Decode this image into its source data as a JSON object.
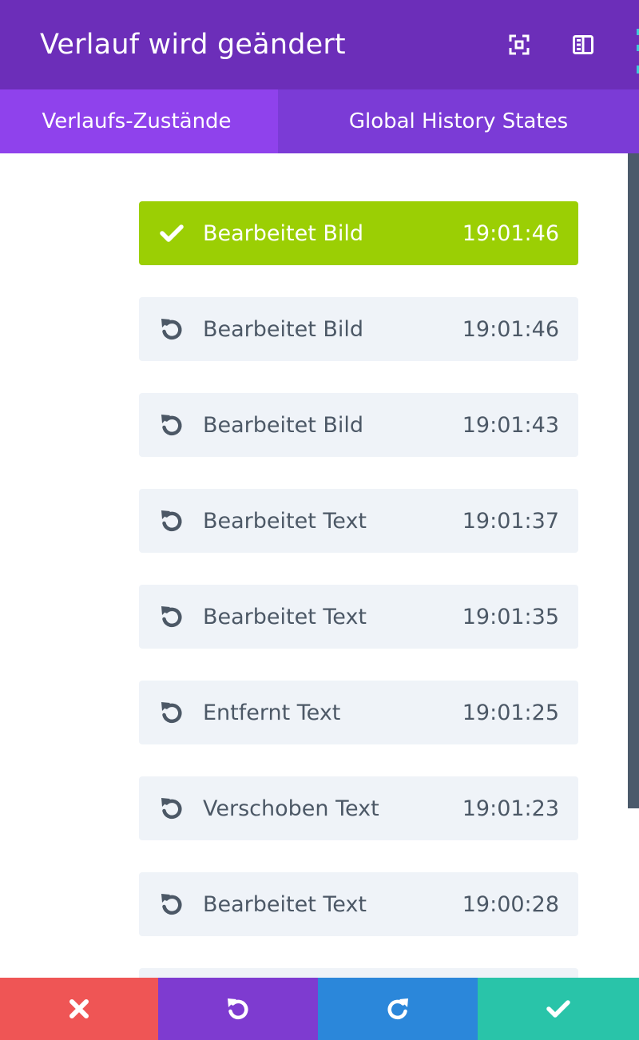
{
  "header": {
    "title": "Verlauf wird geändert",
    "fullscreen_icon": "fullscreen-icon",
    "sidebar_icon": "sidebar-toggle-icon",
    "bg_color": "#6c2eb9"
  },
  "tabs": [
    {
      "label": "Verlaufs-Zustände",
      "active": true
    },
    {
      "label": "Global History States",
      "active": false
    }
  ],
  "history": {
    "items": [
      {
        "label": "Bearbeitet Bild",
        "time": "19:01:46",
        "active": true,
        "icon": "checkmark-icon"
      },
      {
        "label": "Bearbeitet Bild",
        "time": "19:01:46",
        "active": false,
        "icon": "undo-icon"
      },
      {
        "label": "Bearbeitet Bild",
        "time": "19:01:43",
        "active": false,
        "icon": "undo-icon"
      },
      {
        "label": "Bearbeitet Text",
        "time": "19:01:37",
        "active": false,
        "icon": "undo-icon"
      },
      {
        "label": "Bearbeitet Text",
        "time": "19:01:35",
        "active": false,
        "icon": "undo-icon"
      },
      {
        "label": "Entfernt Text",
        "time": "19:01:25",
        "active": false,
        "icon": "undo-icon"
      },
      {
        "label": "Verschoben Text",
        "time": "19:01:23",
        "active": false,
        "icon": "undo-icon"
      },
      {
        "label": "Bearbeitet Text",
        "time": "19:00:28",
        "active": false,
        "icon": "undo-icon"
      }
    ],
    "active_color": "#9bcf04",
    "item_color": "#eff3f8"
  },
  "footer": {
    "buttons": [
      {
        "name": "discard",
        "icon": "close-icon",
        "color": "#ef5555"
      },
      {
        "name": "undo",
        "icon": "undo-icon",
        "color": "#7e3bd0"
      },
      {
        "name": "redo",
        "icon": "redo-icon",
        "color": "#2b87da"
      },
      {
        "name": "save",
        "icon": "checkmark-icon",
        "color": "#29c4a9"
      }
    ]
  }
}
